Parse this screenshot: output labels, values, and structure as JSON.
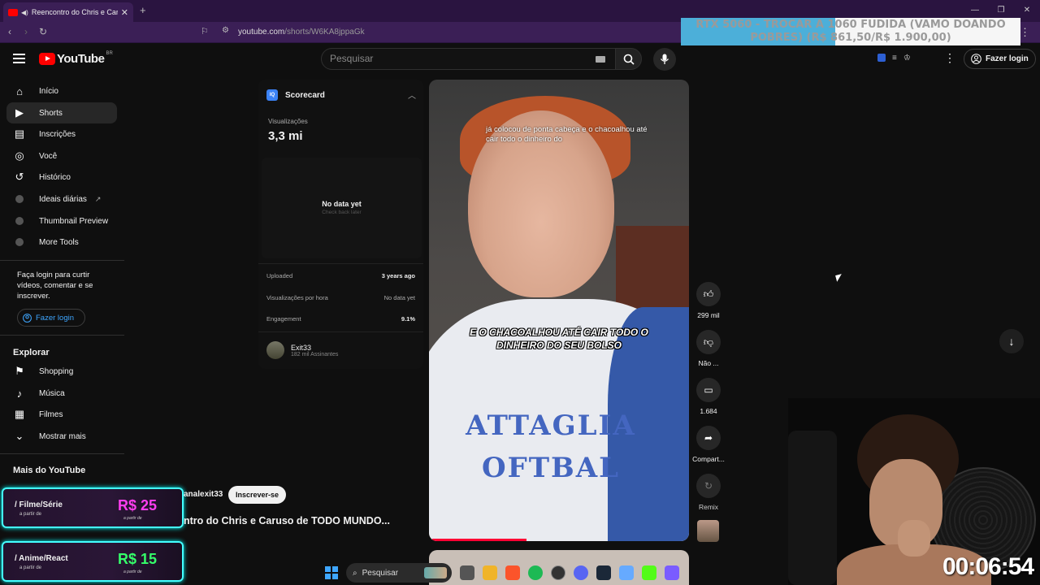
{
  "browser": {
    "tab_title": "Reencontro do Chris e Caruso",
    "new_tab": "+",
    "url_host": "youtube.com",
    "url_path": "/shorts/W6KA8jppaGk",
    "window_controls": [
      "—",
      "❐",
      "✕"
    ]
  },
  "overlay_banner": {
    "text": "RTX 5060 - TROCAR A 1060 FUDIDA (VAMO DOANDO POBRES) (R$ 861,50/R$ 1.900,00)"
  },
  "header": {
    "logo": "YouTube",
    "country": "BR",
    "search_placeholder": "Pesquisar",
    "login_label": "Fazer login"
  },
  "sidebar": {
    "items": [
      {
        "label": "Início",
        "icon": "home-icon"
      },
      {
        "label": "Shorts",
        "icon": "shorts-icon",
        "active": true
      },
      {
        "label": "Inscrições",
        "icon": "subscriptions-icon"
      },
      {
        "label": "Você",
        "icon": "user-icon"
      },
      {
        "label": "Histórico",
        "icon": "history-icon"
      },
      {
        "label": "Ideais diárias",
        "icon": "extension-icon"
      },
      {
        "label": "Thumbnail Preview",
        "icon": "extension-icon"
      },
      {
        "label": "More Tools",
        "icon": "extension-icon"
      }
    ],
    "login_prompt": "Faça login para curtir vídeos, comentar e se inscrever.",
    "login_label": "Fazer login",
    "explore_title": "Explorar",
    "explore_items": [
      {
        "label": "Shopping",
        "icon": "shopping-icon"
      },
      {
        "label": "Música",
        "icon": "music-icon"
      },
      {
        "label": "Filmes",
        "icon": "film-icon"
      },
      {
        "label": "Mostrar mais",
        "icon": "chevron-down-icon"
      }
    ],
    "more_title": "Mais do YouTube"
  },
  "promos": [
    {
      "label": "/ Filme/Série",
      "sub": "a partir de",
      "price": "R$ 25",
      "price_sub": "a partir de"
    },
    {
      "label": "/ Anime/React",
      "sub": "a partir de",
      "price": "R$ 15",
      "price_sub": "a partir de"
    }
  ],
  "scorecard": {
    "title": "Scorecard",
    "views_label": "Visualizações",
    "views_value": "3,3 mi",
    "no_data_title": "No data yet",
    "no_data_sub": "Check back later",
    "rows": [
      {
        "label": "Uploaded",
        "value": "3 years ago"
      },
      {
        "label": "Visualizações por hora",
        "value": "No data yet"
      },
      {
        "label": "Engagement",
        "value": "9.1%"
      }
    ],
    "channel_name": "Exit33",
    "channel_subs": "182 mil Assinantes"
  },
  "video": {
    "caption_top": "já colocou de ponta cabeça e o chacoalhou até cair todo o dinheiro do",
    "caption_main": "E O CHACOALHOU ATÉ CAIR TODO O DINHEIRO DO SEU BOLSO",
    "shirt_text_1": "ATTAGLIA",
    "shirt_text_2": "OFTBAL",
    "progress": 0.36
  },
  "actions": {
    "like_count": "299 mil",
    "dislike_label": "Não ...",
    "comments_count": "1.684",
    "share_label": "Compart...",
    "remix_label": "Remix"
  },
  "meta": {
    "channel_handle": "analexit33",
    "subscribe_label": "Inscrever-se",
    "video_title": "ntro do Chris e Caruso de TODO MUNDO..."
  },
  "stream": {
    "timer": "00:06:54"
  },
  "taskbar": {
    "search_label": "Pesquisar"
  }
}
